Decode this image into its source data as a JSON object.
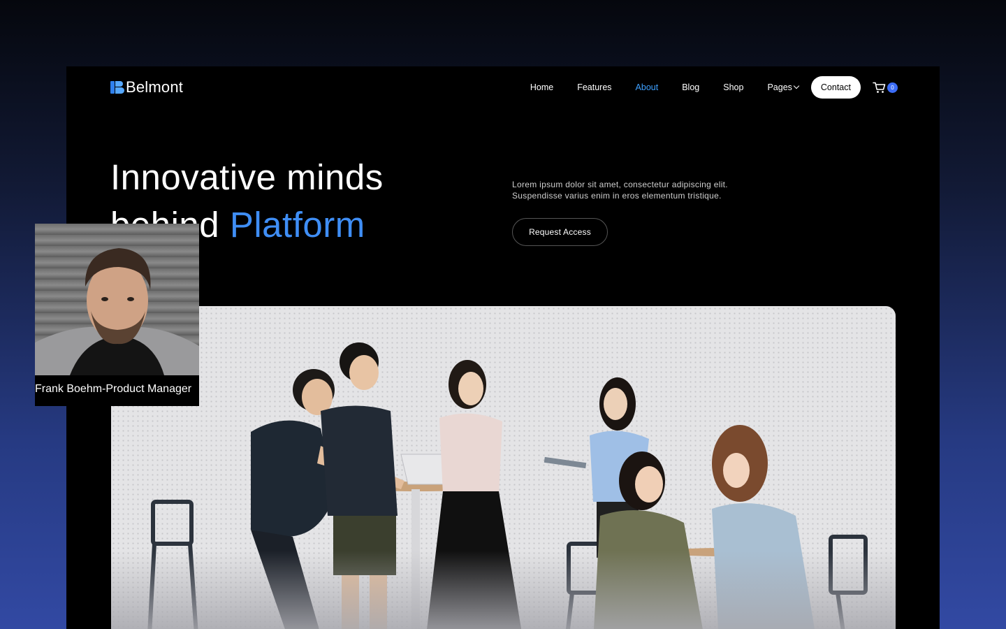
{
  "brand": {
    "name": "Belmont"
  },
  "nav": {
    "items": [
      {
        "label": "Home",
        "active": false
      },
      {
        "label": "Features",
        "active": false
      },
      {
        "label": "About",
        "active": true
      },
      {
        "label": "Blog",
        "active": false
      },
      {
        "label": "Shop",
        "active": false
      }
    ],
    "pages_label": "Pages",
    "contact_label": "Contact",
    "cart_count": "0"
  },
  "hero": {
    "title_line1": "Innovative minds",
    "title_line2_prefix": "behind ",
    "title_line2_accent": "Platform",
    "description_line1": "Lorem ipsum dolor sit amet, consectetur adipiscing elit.",
    "description_line2": "Suspendisse varius enim in eros elementum tristique.",
    "cta_label": "Request Access"
  },
  "profile_card": {
    "caption": "Frank Boehm-Product Manager"
  },
  "colors": {
    "accent": "#3f8ef5",
    "active_link": "#3ea0ff",
    "badge": "#3b6cf6",
    "background": "#000000"
  }
}
